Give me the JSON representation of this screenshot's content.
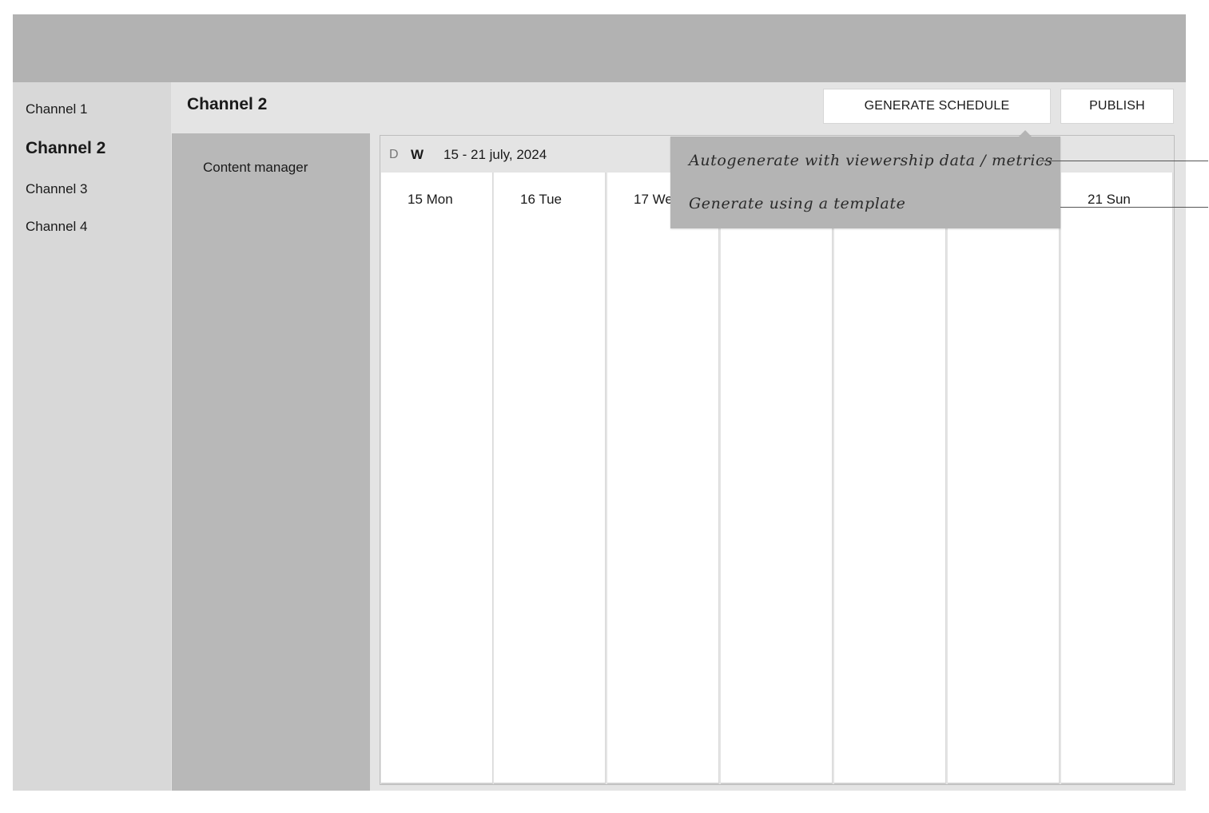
{
  "sidebar": {
    "items": [
      {
        "label": "Channel 1"
      },
      {
        "label": "Channel 2"
      },
      {
        "label": "Channel 3"
      },
      {
        "label": "Channel 4"
      }
    ]
  },
  "main": {
    "title": "Channel 2",
    "generate_label": "GENERATE SCHEDULE",
    "publish_label": "PUBLISH"
  },
  "content_manager": {
    "label": "Content manager"
  },
  "calendar": {
    "view_day": "D",
    "view_week": "W",
    "range": "15 - 21 july, 2024",
    "days": [
      "15 Mon",
      "16 Tue",
      "17 We",
      "",
      "",
      "",
      "21 Sun"
    ]
  },
  "generate_menu": {
    "items": [
      "Autogenerate with viewership data / metrics",
      "Generate using a template"
    ]
  }
}
